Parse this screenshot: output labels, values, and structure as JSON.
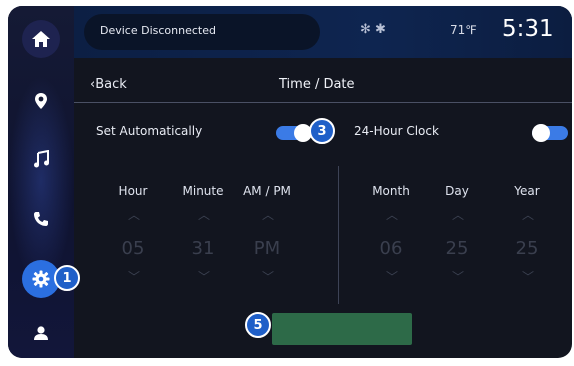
{
  "status_bar": {
    "connection_text": "Device Disconnected",
    "status_icons": "✻ ✱",
    "temperature": "71℉",
    "time": "5:31"
  },
  "header": {
    "back_label": "‹Back",
    "title": "Time / Date"
  },
  "settings": {
    "set_automatically_label": "Set Automatically",
    "set_automatically_on": true,
    "clock_24h_label": "24-Hour Clock",
    "clock_24h_on": false
  },
  "time_picker": {
    "columns": [
      {
        "label": "Hour",
        "value": "05"
      },
      {
        "label": "Minute",
        "value": "31"
      },
      {
        "label": "AM / PM",
        "value": "PM"
      }
    ]
  },
  "date_picker": {
    "columns": [
      {
        "label": "Month",
        "value": "06"
      },
      {
        "label": "Day",
        "value": "25"
      },
      {
        "label": "Year",
        "value": "25"
      }
    ]
  },
  "callouts": {
    "one": "1",
    "three": "3",
    "five": "5"
  },
  "icons": {
    "rail": [
      "home-icon",
      "location-icon",
      "music-icon",
      "phone-icon",
      "settings-icon",
      "profile-icon"
    ]
  },
  "colors": {
    "accent": "#2b6fe0",
    "save_bar": "#2d6a48",
    "callout": "#1f5fc8"
  }
}
